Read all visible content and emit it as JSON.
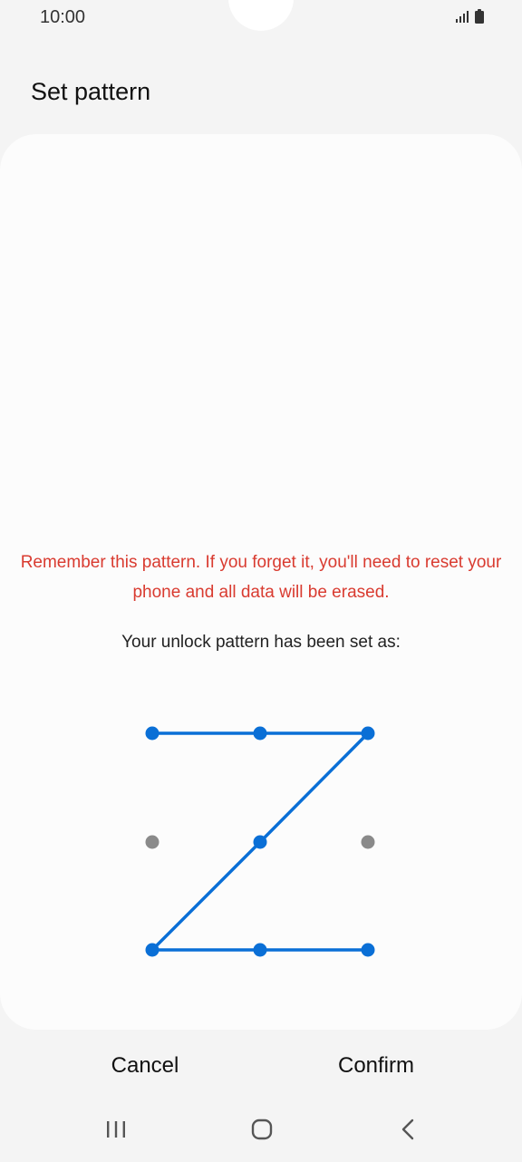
{
  "status_bar": {
    "time": "10:00",
    "signal_icon": "signal-icon",
    "battery_icon": "battery-icon"
  },
  "header": {
    "title": "Set pattern"
  },
  "main": {
    "warning": "Remember this pattern. If you forget it, you'll need to reset your phone and all data will be erased.",
    "info": "Your unlock pattern has been set as:",
    "pattern": {
      "grid": "3x3",
      "sequence": [
        1,
        2,
        3,
        5,
        7,
        8,
        9
      ],
      "active_color": "#0a6fd6",
      "inactive_color": "#8a8a8a"
    }
  },
  "footer": {
    "cancel_label": "Cancel",
    "confirm_label": "Confirm"
  },
  "nav_bar": {
    "recent_icon": "recent-apps-icon",
    "home_icon": "home-icon",
    "back_icon": "back-icon"
  },
  "colors": {
    "warning": "#d93b30",
    "accent": "#0a6fd6",
    "background": "#f4f4f4",
    "card": "#fcfcfc"
  }
}
